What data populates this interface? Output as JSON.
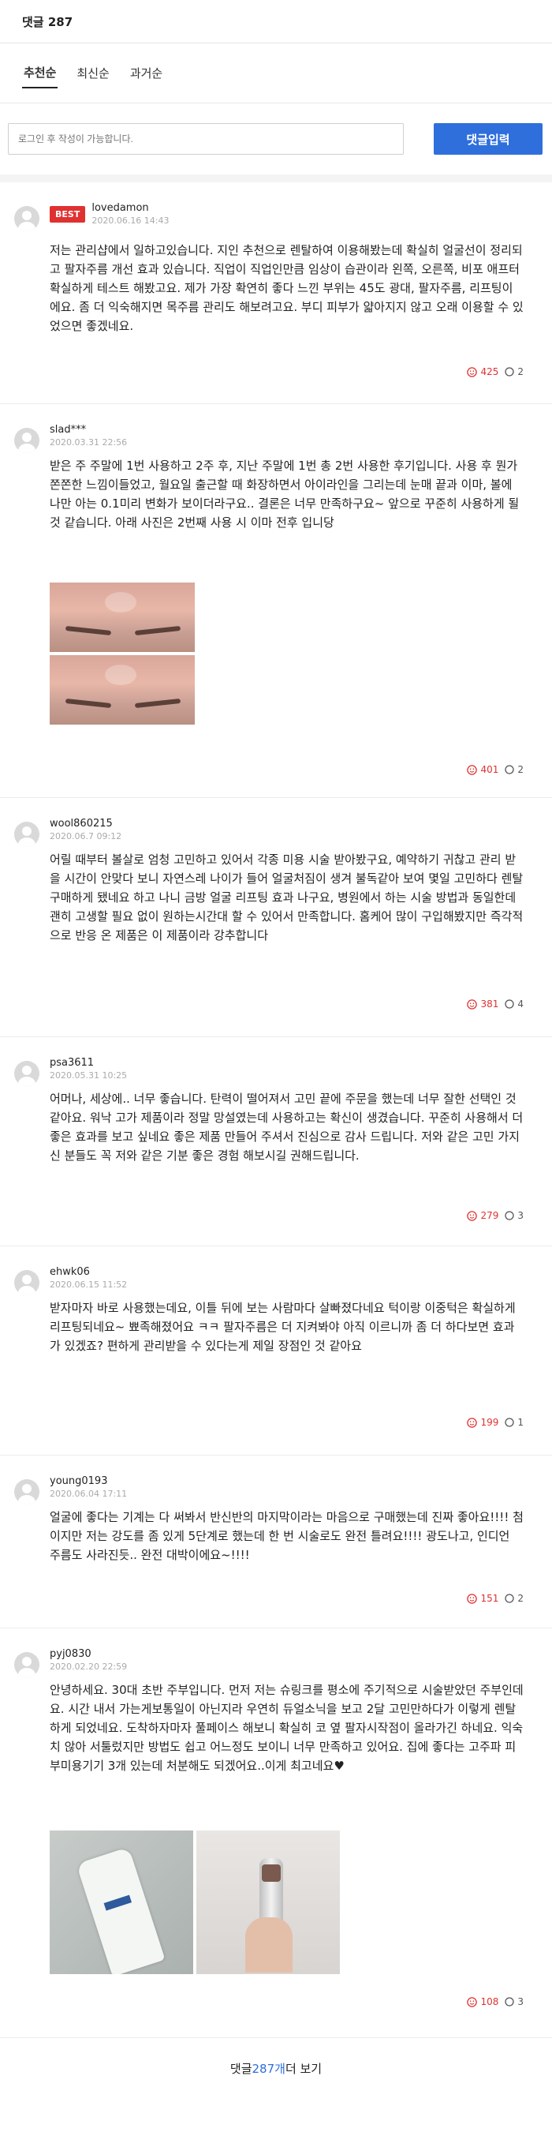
{
  "header": {
    "title": "댓글 287"
  },
  "tabs": [
    {
      "label": "추천순",
      "active": true
    },
    {
      "label": "최신순",
      "active": false
    },
    {
      "label": "과거순",
      "active": false
    }
  ],
  "input": {
    "placeholder": "로그인 후 작성이 가능합니다.",
    "submit_label": "댓글입력"
  },
  "comments": [
    {
      "badge": "BEST",
      "user": "lovedamon",
      "date": "2020.06.16 14:43",
      "text": "저는 관리샵에서 일하고있습니다. 지인 추천으로 렌탈하여 이용해봤는데 확실히 얼굴선이 정리되고 팔자주름 개선 효과 있습니다. 직업이 직업인만큼 임상이 습관이라 왼쪽, 오른쪽, 비포 애프터 확실하게 테스트 해봤고요. 제가 가장 확연히 좋다 느낀 부위는 45도 광대, 팔자주름, 리프팅이에요. 좀 더 익숙해지면 목주름 관리도 해보려고요. 부디 피부가 얇아지지 않고 오래 이용할 수 있었으면 좋겠네요.",
      "likes": "425",
      "replies": "2"
    },
    {
      "user": "slad***",
      "date": "2020.03.31 22:56",
      "text": "받은 주 주말에 1번 사용하고 2주 후, 지난 주말에 1번 총 2번 사용한 후기입니다. 사용 후 뭔가 쫀쫀한 느낌이들었고, 월요일 출근할 때 화장하면서 아이라인을 그리는데 눈매 끝과 이마, 볼에 나만 아는 0.1미리 변화가 보이더라구요.. 결론은 너무 만족하구요~ 앞으로 꾸준히 사용하게 될 것 같습니다. 아래 사진은 2번째 사용 시 이마 전후 입니당",
      "likes": "401",
      "replies": "2"
    },
    {
      "user": "wool860215",
      "date": "2020.06.7 09:12",
      "text": "어릴 때부터 볼살로 엄청 고민하고 있어서 각종 미용 시술 받아봤구요, 예약하기 귀찮고 관리 받을 시간이 안맞다 보니 자연스레 나이가 들어 얼굴처짐이 생겨 불독같아 보여 몇일 고민하다 렌탈 구매하게 됐네요 하고 나니 금방 얼굴 리프팅 효과 나구요, 병원에서 하는 시술 방법과 동일한데 괜히 고생할 필요 없이 원하는시간대 할 수 있어서 만족합니다. 홈케어 많이 구입해봤지만 즉각적으로 반응 온 제품은 이 제품이라 강추합니다",
      "likes": "381",
      "replies": "4"
    },
    {
      "user": "psa3611",
      "date": "2020.05.31 10:25",
      "text": "어머나, 세상에.. 너무 좋습니다. 탄력이 떨어져서 고민 끝에 주문을 했는데 너무 잘한 선택인 것 같아요. 워낙 고가 제품이라 정말 망설였는데 사용하고는 확신이 생겼습니다. 꾸준히 사용해서 더 좋은 효과를 보고 싶네요 좋은 제품 만들어 주셔서 진심으로 감사 드립니다. 저와 같은 고민 가지신 분들도 꼭 저와 같은 기분 좋은 경험 해보시길 권해드립니다.",
      "likes": "279",
      "replies": "3"
    },
    {
      "user": "ehwk06",
      "date": "2020.06.15 11:52",
      "text": "받자마자 바로 사용했는데요, 이틀 뒤에 보는 사람마다 살빠졌다네요 턱이랑 이중턱은 확실하게 리프팅되네요~ 뾰족해졌어요 ㅋㅋ 팔자주름은 더 지켜봐야 아직 이르니까 좀 더 하다보면 효과가 있겠죠? 편하게 관리받을 수 있다는게 제일 장점인 것 같아요",
      "likes": "199",
      "replies": "1"
    },
    {
      "user": "young0193",
      "date": "2020.06.04 17:11",
      "text": "얼굴에 좋다는 기계는 다 써봐서 반신반의 마지막이라는 마음으로 구매했는데 진짜 좋아요!!!! 첨이지만 저는 강도를 좀 있게 5단계로 했는데 한 번 시술로도 완전 틀려요!!!! 광도나고, 인디언 주름도 사라진듯.. 완전 대박이에요~!!!!",
      "likes": "151",
      "replies": "2"
    },
    {
      "user": "pyj0830",
      "date": "2020.02.20 22:59",
      "text": "안녕하세요. 30대 초반 주부입니다. 먼저 저는 슈링크를 평소에 주기적으로 시술받았던 주부인데요. 시간 내서 가는게보통일이 아닌지라 우연히 듀얼소닉을 보고 2달 고민만하다가 이렇게 렌탈하게 되었네요. 도착하자마자 풀페이스 해보니 확실히 코 옆 팔자시작점이 올라가긴 하네요. 익숙치 않아 서툴렀지만 방법도 쉽고 어느정도 보이니 너무 만족하고 있어요. 집에 좋다는 고주파 피부미용기기 3개 있는데 처분해도 되겠어요..이게 최고네요♥",
      "likes": "108",
      "replies": "3"
    }
  ],
  "more": {
    "prefix": "댓글 ",
    "count": "287개",
    "suffix": " 더 보기"
  },
  "colors": {
    "accent": "#2f6fdc",
    "best": "#e03131",
    "like": "#e03131"
  }
}
